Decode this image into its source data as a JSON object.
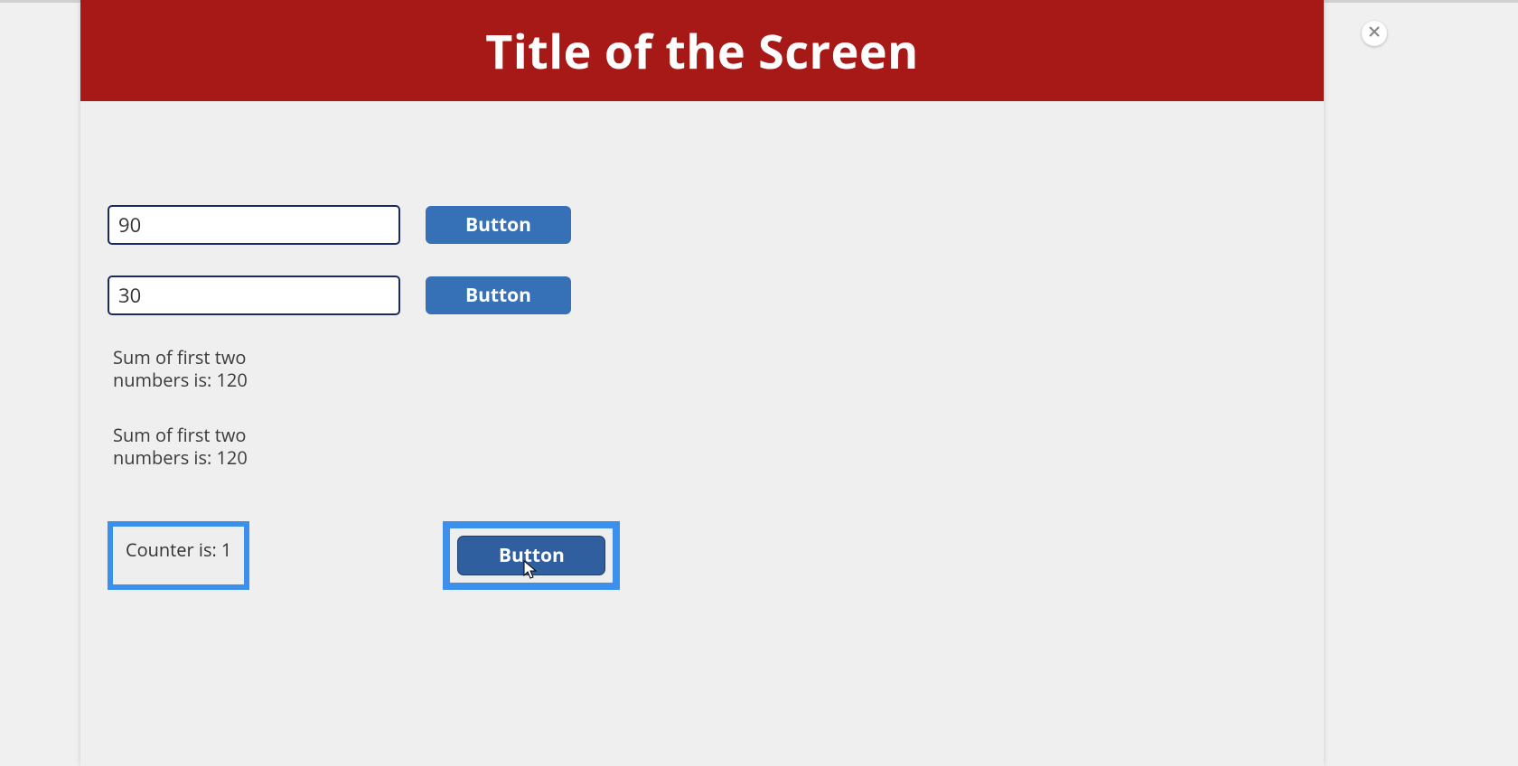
{
  "header": {
    "title": "Title of the Screen"
  },
  "inputs": {
    "first": {
      "value": "90"
    },
    "second": {
      "value": "30"
    }
  },
  "buttons": {
    "row1": "Button",
    "row2": "Button",
    "counter": "Button"
  },
  "sum": {
    "line1": "Sum of first two numbers is: 120",
    "line2": "Sum of first two numbers is: 120"
  },
  "counter": {
    "label": "Counter is: 1"
  }
}
